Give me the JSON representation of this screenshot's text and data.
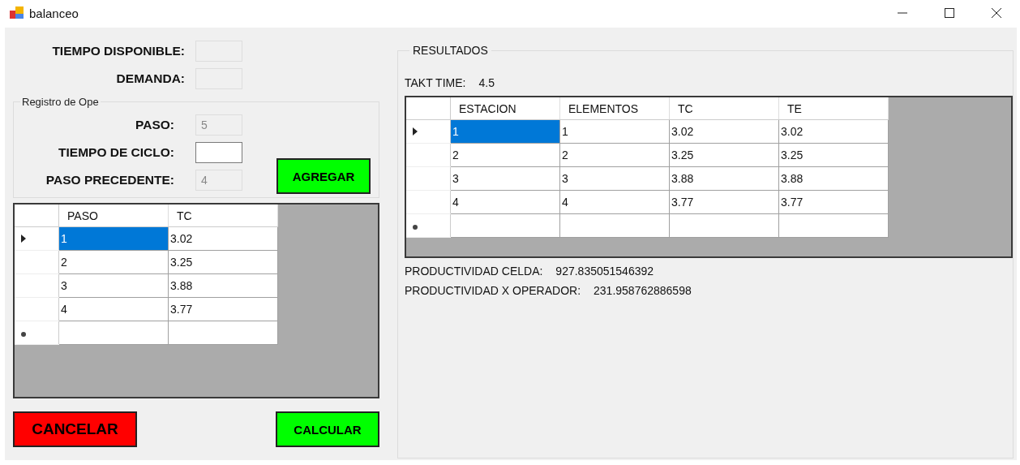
{
  "window": {
    "title": "balanceo"
  },
  "inputs": [
    {
      "label": "TIEMPO DISPONIBLE:",
      "disabled": true
    },
    {
      "label": "DEMANDA:",
      "disabled": true
    }
  ],
  "registro": {
    "title": "Registro de Ope",
    "fields": [
      {
        "label": "PASO:",
        "value": "5",
        "disabled": true
      },
      {
        "label": "TIEMPO DE CICLO:",
        "disabled": false
      },
      {
        "label": "PASO PRECEDENTE:",
        "value": "4",
        "disabled": true
      }
    ],
    "button": "AGREGAR"
  },
  "pasos_table": {
    "columns": [
      "PASO",
      "TC"
    ],
    "rows": [
      {
        "kind": "data",
        "selected": true,
        "cells": [
          "1",
          "3.02"
        ]
      },
      {
        "kind": "data",
        "selected": false,
        "cells": [
          "2",
          "3.25"
        ]
      },
      {
        "kind": "data",
        "selected": false,
        "cells": [
          "3",
          "3.88"
        ]
      },
      {
        "kind": "data",
        "selected": false,
        "cells": [
          "4",
          "3.77"
        ]
      },
      {
        "kind": "new",
        "selected": false,
        "cells": []
      }
    ]
  },
  "buttons": {
    "cancel": "CANCELAR",
    "calculate": "CALCULAR"
  },
  "resultados": {
    "title": "RESULTADOS",
    "takt_label": "TAKT TIME:",
    "takt_value": "4.5",
    "table": {
      "columns": [
        "ESTACION",
        "ELEMENTOS",
        "TC",
        "TE"
      ],
      "rows": [
        {
          "kind": "data",
          "selected": true,
          "cells": [
            "1",
            "1",
            "3.02",
            "3.02"
          ]
        },
        {
          "kind": "data",
          "selected": false,
          "cells": [
            "2",
            "2",
            "3.25",
            "3.25"
          ]
        },
        {
          "kind": "data",
          "selected": false,
          "cells": [
            "3",
            "3",
            "3.88",
            "3.88"
          ]
        },
        {
          "kind": "data",
          "selected": false,
          "cells": [
            "4",
            "4",
            "3.77",
            "3.77"
          ]
        },
        {
          "kind": "new",
          "selected": false,
          "cells": []
        }
      ]
    },
    "stats": [
      {
        "label": "PRODUCTIVIDAD CELDA:",
        "value": "927.835051546392"
      },
      {
        "label": "PRODUCTIVIDAD X OPERADOR:",
        "value": "231.958762886598"
      }
    ]
  }
}
